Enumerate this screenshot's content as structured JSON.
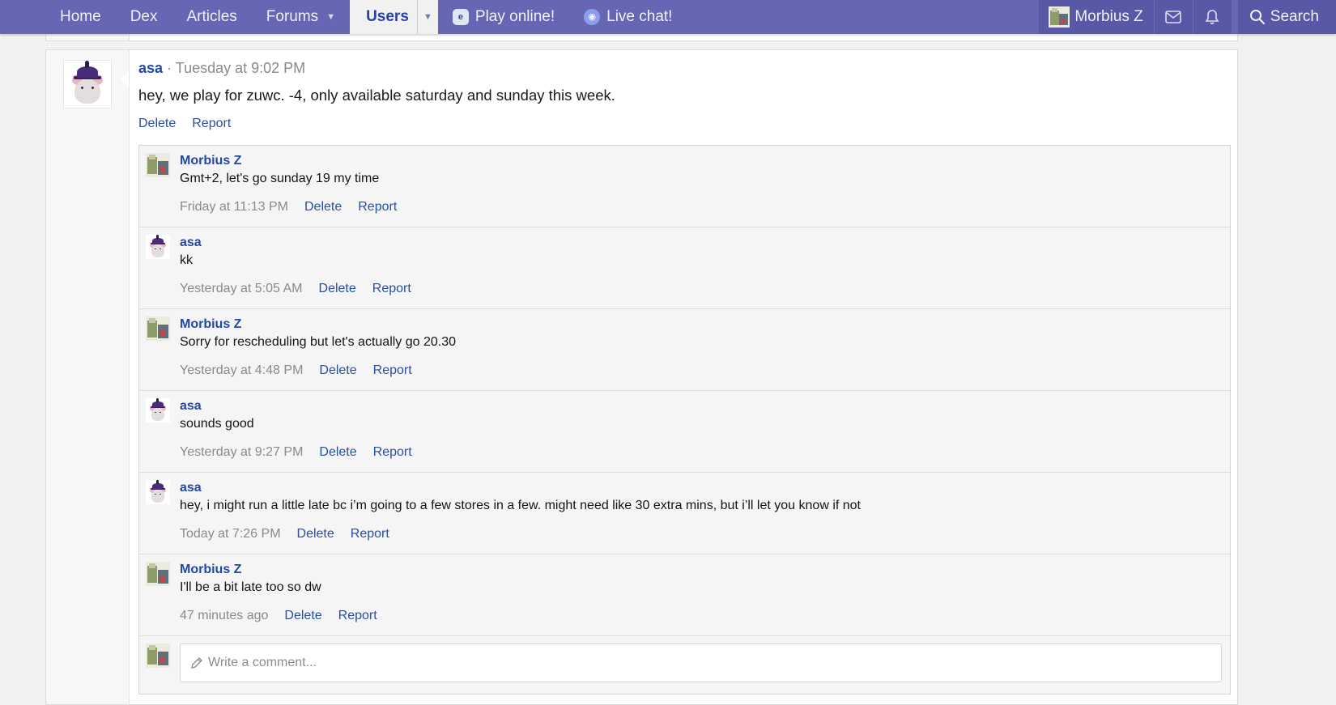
{
  "nav": {
    "home": "Home",
    "dex": "Dex",
    "articles": "Articles",
    "forums": "Forums",
    "users": "Users",
    "play": "Play online!",
    "chat": "Live chat!",
    "account": "Morbius Z",
    "search": "Search",
    "icons": {
      "inbox": "envelope-icon",
      "alerts": "bell-icon",
      "search": "magnifier-icon"
    }
  },
  "post": {
    "author": "asa",
    "separator": "·",
    "time": "Tuesday at 9:02 PM",
    "text": "hey, we play for zuwc. -4, only available saturday and sunday this week.",
    "delete": "Delete",
    "report": "Report"
  },
  "comments": [
    {
      "author": "Morbius Z",
      "text": "Gmt+2, let's go sunday 19 my time",
      "time": "Friday at 11:13 PM",
      "delete": "Delete",
      "report": "Report"
    },
    {
      "author": "asa",
      "text": "kk",
      "time": "Yesterday at 5:05 AM",
      "delete": "Delete",
      "report": "Report"
    },
    {
      "author": "Morbius Z",
      "text": "Sorry for rescheduling but let's actually go 20.30",
      "time": "Yesterday at 4:48 PM",
      "delete": "Delete",
      "report": "Report"
    },
    {
      "author": "asa",
      "text": "sounds good",
      "time": "Yesterday at 9:27 PM",
      "delete": "Delete",
      "report": "Report"
    },
    {
      "author": "asa",
      "text": "hey, i might run a little late bc i’m going to a few stores in a few. might need like 30 extra mins, but i’ll let you know if not",
      "time": "Today at 7:26 PM",
      "delete": "Delete",
      "report": "Report"
    },
    {
      "author": "Morbius Z",
      "text": "I'll be a bit late too so dw",
      "time": "47 minutes ago",
      "delete": "Delete",
      "report": "Report"
    }
  ],
  "comment_box": {
    "placeholder": "Write a comment..."
  },
  "colors": {
    "nav_bg": "#6666b4",
    "link": "#2547a4",
    "muted": "#8a8a8a"
  }
}
